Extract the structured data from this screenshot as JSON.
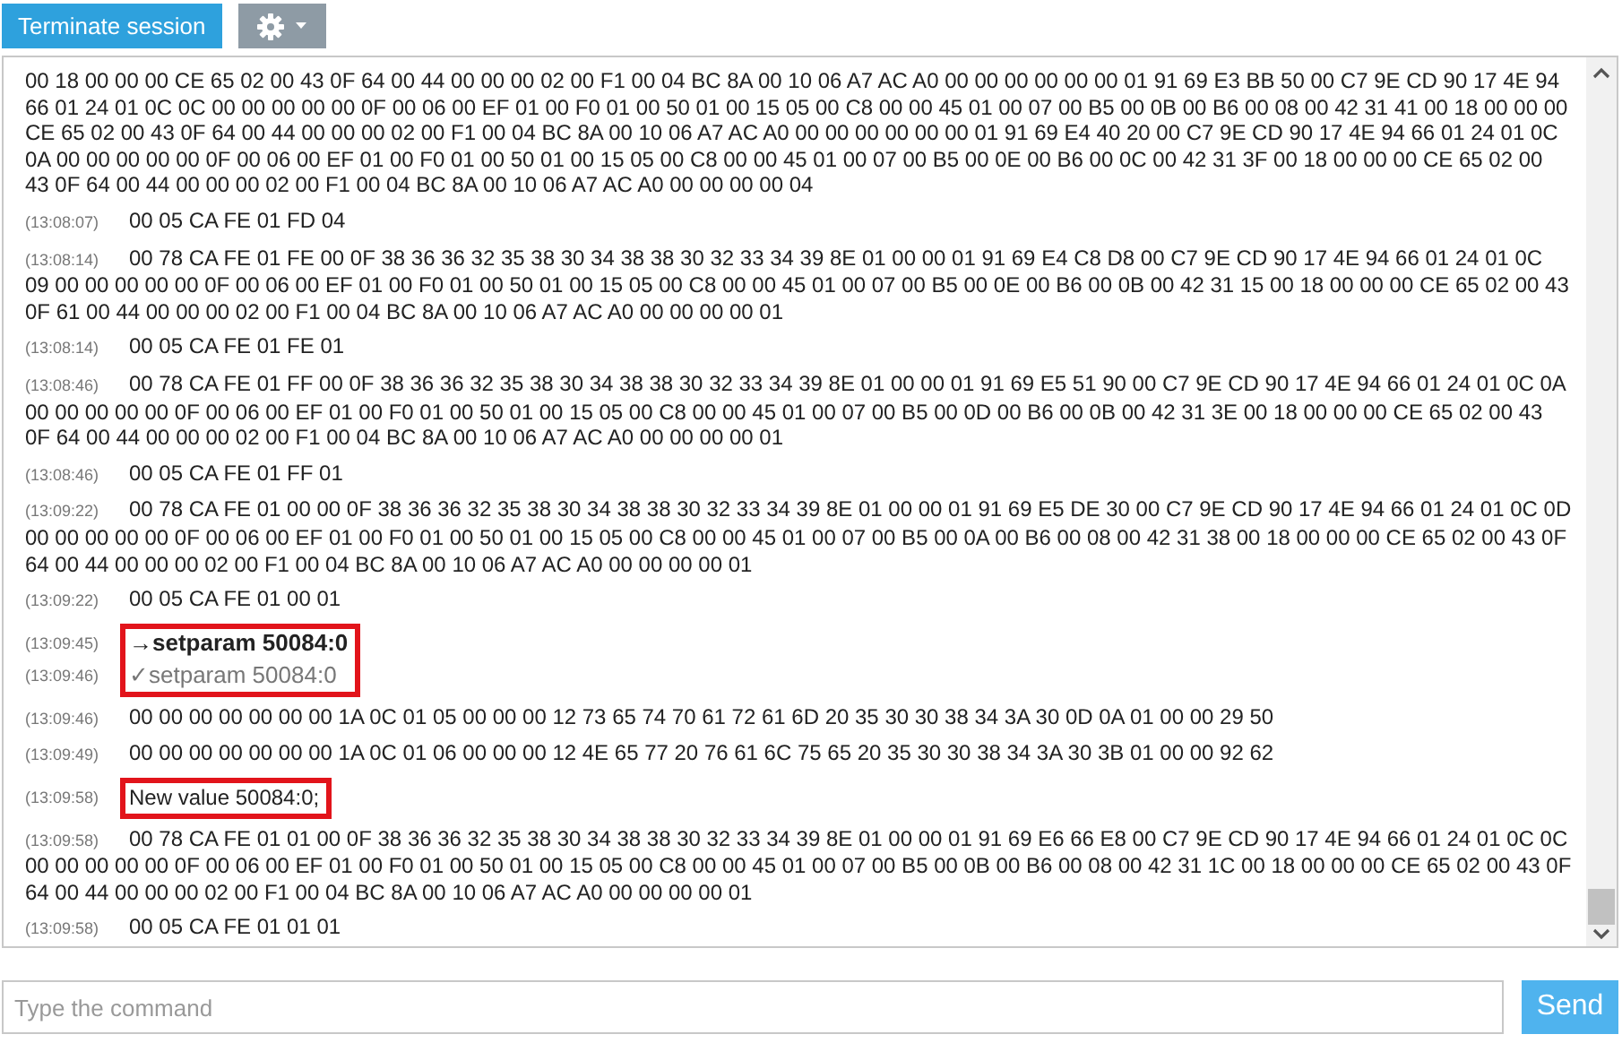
{
  "toolbar": {
    "terminate_button": "Terminate session"
  },
  "log": [
    {
      "kind": "hex",
      "text": "00 18 00 00 00 CE 65 02 00 43 0F 64 00 44 00 00 00 02 00 F1 00 04 BC 8A 00 10 06 A7 AC A0 00 00 00 00 00 00 01 91 69 E3 BB 50 00 C7 9E CD 90 17 4E 94 66 01 24 01 0C 0C 00 00 00 00 00 0F 00 06 00 EF 01 00 F0 01 00 50 01 00 15 05 00 C8 00 00 45 01 00 07 00 B5 00 0B 00 B6 00 08 00 42 31 41 00 18 00 00 00 CE 65 02 00 43 0F 64 00 44 00 00 00 02 00 F1 00 04 BC 8A 00 10 06 A7 AC A0 00 00 00 00 00 00 01 91 69 E4 40 20 00 C7 9E CD 90 17 4E 94 66 01 24 01 0C 0A 00 00 00 00 00 0F 00 06 00 EF 01 00 F0 01 00 50 01 00 15 05 00 C8 00 00 45 01 00 07 00 B5 00 0E 00 B6 00 0C 00 42 31 3F 00 18 00 00 00 CE 65 02 00 43 0F 64 00 44 00 00 00 02 00 F1 00 04 BC 8A 00 10 06 A7 AC A0 00 00 00 00 04"
    },
    {
      "kind": "hex",
      "time": "(13:08:07)",
      "text": "00 05 CA FE 01 FD 04"
    },
    {
      "kind": "hex",
      "time": "(13:08:14)",
      "text": "00 78 CA FE 01 FE 00 0F 38 36 36 32 35 38 30 34 38 38 30 32 33 34 39 8E 01 00 00 01 91 69 E4 C8 D8 00 C7 9E CD 90 17 4E 94 66 01 24 01 0C 09 00 00 00 00 00 0F 00 06 00 EF 01 00 F0 01 00 50 01 00 15 05 00 C8 00 00 45 01 00 07 00 B5 00 0E 00 B6 00 0B 00 42 31 15 00 18 00 00 00 CE 65 02 00 43 0F 61 00 44 00 00 00 02 00 F1 00 04 BC 8A 00 10 06 A7 AC A0 00 00 00 00 01"
    },
    {
      "kind": "hex",
      "time": "(13:08:14)",
      "text": "00 05 CA FE 01 FE 01"
    },
    {
      "kind": "hex",
      "time": "(13:08:46)",
      "text": "00 78 CA FE 01 FF 00 0F 38 36 36 32 35 38 30 34 38 38 30 32 33 34 39 8E 01 00 00 01 91 69 E5 51 90 00 C7 9E CD 90 17 4E 94 66 01 24 01 0C 0A 00 00 00 00 00 0F 00 06 00 EF 01 00 F0 01 00 50 01 00 15 05 00 C8 00 00 45 01 00 07 00 B5 00 0D 00 B6 00 0B 00 42 31 3E 00 18 00 00 00 CE 65 02 00 43 0F 64 00 44 00 00 00 02 00 F1 00 04 BC 8A 00 10 06 A7 AC A0 00 00 00 00 01"
    },
    {
      "kind": "hex",
      "time": "(13:08:46)",
      "text": "00 05 CA FE 01 FF 01"
    },
    {
      "kind": "hex",
      "time": "(13:09:22)",
      "text": "00 78 CA FE 01 00 00 0F 38 36 36 32 35 38 30 34 38 38 30 32 33 34 39 8E 01 00 00 01 91 69 E5 DE 30 00 C7 9E CD 90 17 4E 94 66 01 24 01 0C 0D 00 00 00 00 00 0F 00 06 00 EF 01 00 F0 01 00 50 01 00 15 05 00 C8 00 00 45 01 00 07 00 B5 00 0A 00 B6 00 08 00 42 31 38 00 18 00 00 00 CE 65 02 00 43 0F 64 00 44 00 00 00 02 00 F1 00 04 BC 8A 00 10 06 A7 AC A0 00 00 00 00 01"
    },
    {
      "kind": "hex",
      "time": "(13:09:22)",
      "text": "00 05 CA FE 01 00 01"
    },
    {
      "kind": "highlight",
      "entries": [
        {
          "kind": "sent",
          "time": "(13:09:45)",
          "marker": "→",
          "text": "setparam 50084:0"
        },
        {
          "kind": "ack",
          "time": "(13:09:46)",
          "marker": "✓",
          "text": "setparam 50084:0"
        }
      ]
    },
    {
      "kind": "hex",
      "time": "(13:09:46)",
      "text": "00 00 00 00 00 00 00 1A 0C 01 05 00 00 00 12 73 65 74 70 61 72 61 6D 20 35 30 30 38 34 3A 30 0D 0A 01 00 00 29 50"
    },
    {
      "kind": "hex",
      "time": "(13:09:49)",
      "text": "00 00 00 00 00 00 00 1A 0C 01 06 00 00 00 12 4E 65 77 20 76 61 6C 75 65 20 35 30 30 38 34 3A 30 3B 01 00 00 92 62"
    },
    {
      "kind": "highlight",
      "entries": [
        {
          "kind": "text",
          "time": "(13:09:58)",
          "text": "New value 50084:0;"
        }
      ]
    },
    {
      "kind": "hex",
      "time": "(13:09:58)",
      "text": "00 78 CA FE 01 01 00 0F 38 36 36 32 35 38 30 34 38 38 30 32 33 34 39 8E 01 00 00 01 91 69 E6 66 E8 00 C7 9E CD 90 17 4E 94 66 01 24 01 0C 0C 00 00 00 00 00 0F 00 06 00 EF 01 00 F0 01 00 50 01 00 15 05 00 C8 00 00 45 01 00 07 00 B5 00 0B 00 B6 00 08 00 42 31 1C 00 18 00 00 00 CE 65 02 00 43 0F 64 00 44 00 00 00 02 00 F1 00 04 BC 8A 00 10 06 A7 AC A0 00 00 00 00 01"
    },
    {
      "kind": "hex",
      "time": "(13:09:58)",
      "text": "00 05 CA FE 01 01 01"
    }
  ],
  "command": {
    "placeholder": "Type the command",
    "send_button": "Send"
  }
}
